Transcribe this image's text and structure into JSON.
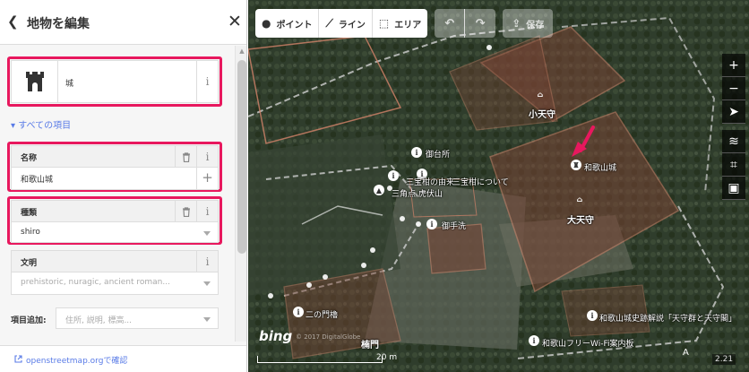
{
  "sidebar": {
    "title": "地物を編集",
    "preset": {
      "name": "城",
      "icon": "castle-icon"
    },
    "all_fields_label": "▾ すべての項目",
    "fields": [
      {
        "label": "名称",
        "value": "和歌山城"
      },
      {
        "label": "種類",
        "value": "shiro"
      },
      {
        "label": "文明",
        "placeholder": "prehistoric, nuragic, ancient roman..."
      }
    ],
    "add_field": {
      "label": "項目追加:",
      "placeholder": "住所, 説明, 標高..."
    },
    "footer_link": "openstreetmap.orgで確認"
  },
  "toolbar": {
    "point": "ポイント",
    "line": "ライン",
    "area": "エリア",
    "save": "保存"
  },
  "map": {
    "labels": {
      "oshinsho": "御台所",
      "sanbo1": "三宝柑の由来",
      "sanbo2": "三宝柑について",
      "sankaku": "三角点 虎伏山",
      "kotenshu": "小天守",
      "wakayama_castle": "和歌山城",
      "daitenshu": "大天守",
      "tearai": "御手洗",
      "ninomon": "二の門櫓",
      "kaisetsu": "和歌山城史跡解説「天守群と天守閣」",
      "wifi": "和歌山フリーWi-Fi案内板",
      "gate": "楠門"
    },
    "attribution": "© 2017 DigitalGlobe",
    "bing": "bing",
    "scale": "20 m",
    "version": "2.21"
  },
  "colors": {
    "highlight": "#e8185e",
    "accent": "#597be7",
    "building_fill": "#8a4a3a",
    "area_stroke": "#d4836a"
  }
}
